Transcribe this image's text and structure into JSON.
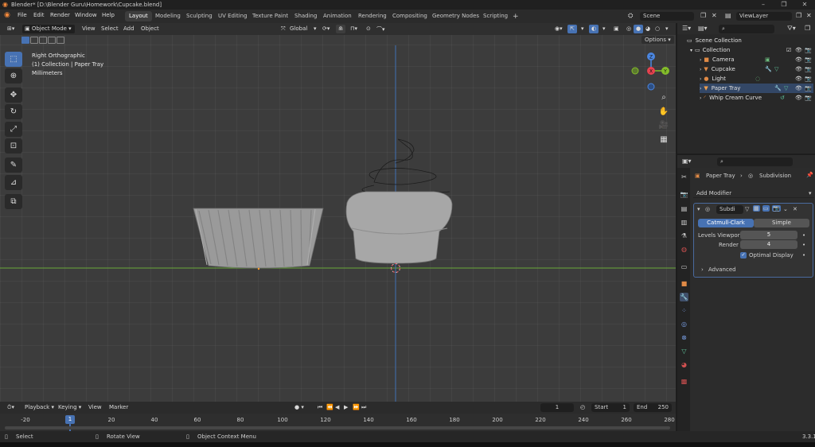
{
  "window": {
    "title": "Blender* [D:\\Blender Guru\\Homework\\Cupcake.blend]"
  },
  "menus": [
    "File",
    "Edit",
    "Render",
    "Window",
    "Help"
  ],
  "workspaces": [
    "Layout",
    "Modeling",
    "Sculpting",
    "UV Editing",
    "Texture Paint",
    "Shading",
    "Animation",
    "Rendering",
    "Compositing",
    "Geometry Nodes",
    "Scripting"
  ],
  "active_workspace": "Layout",
  "scene": {
    "name": "Scene",
    "view_layer": "ViewLayer"
  },
  "viewport": {
    "mode": "Object Mode",
    "menus": [
      "View",
      "Select",
      "Add",
      "Object"
    ],
    "orientation": "Global",
    "options_label": "Options",
    "overlay_lines": [
      "Right Orthographic",
      "(1) Collection | Paper Tray",
      "Millimeters"
    ],
    "gizmo_axes": {
      "z": "Z",
      "y": "Y",
      "x": "X"
    }
  },
  "outliner": {
    "root": "Scene Collection",
    "collection": "Collection",
    "items": [
      {
        "name": "Camera"
      },
      {
        "name": "Cupcake"
      },
      {
        "name": "Light"
      },
      {
        "name": "Paper Tray"
      },
      {
        "name": "Whip Cream Curve"
      }
    ]
  },
  "properties": {
    "breadcrumb_object": "Paper Tray",
    "breadcrumb_modifier": "Subdivision",
    "add_modifier_label": "Add Modifier",
    "modifier_name": "Subdi",
    "mode_catmull": "Catmull-Clark",
    "mode_simple": "Simple",
    "levels_viewport_label": "Levels Viewport",
    "levels_viewport_value": "5",
    "render_label": "Render",
    "render_value": "4",
    "optimal_display_label": "Optimal Display",
    "advanced_label": "Advanced"
  },
  "timeline": {
    "menus": [
      "Playback",
      "Keying",
      "View",
      "Marker"
    ],
    "current_frame": "1",
    "start_label": "Start",
    "start_value": "1",
    "end_label": "End",
    "end_value": "250",
    "ticks": [
      "-20",
      "20",
      "40",
      "60",
      "80",
      "100",
      "120",
      "140",
      "160",
      "180",
      "200",
      "220",
      "240",
      "260",
      "280"
    ],
    "playhead_label": "1"
  },
  "statusbar": {
    "select": "Select",
    "rotate": "Rotate View",
    "context": "Object Context Menu",
    "version": "3.3.1"
  },
  "colors": {
    "accent": "#4772b3",
    "x_axis": "#e8424f",
    "y_axis": "#84bd2a",
    "z_axis": "#4b86e0",
    "grid_line": "#6aa83a"
  }
}
